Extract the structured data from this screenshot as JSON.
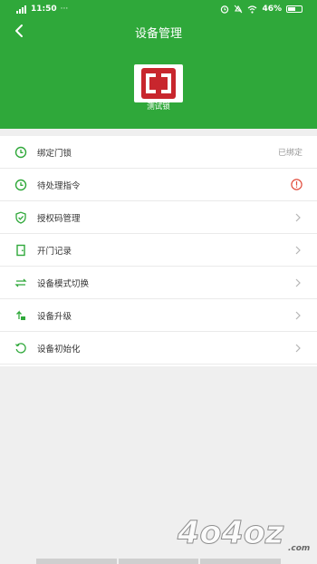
{
  "status_bar": {
    "time": "11:50",
    "battery": "46%"
  },
  "header": {
    "title": "设备管理"
  },
  "device": {
    "name": "测试锁"
  },
  "menu": [
    {
      "label": "绑定门锁",
      "status": "已绑定",
      "icon": "clock-icon"
    },
    {
      "label": "待处理指令",
      "icon": "clock-icon",
      "badge": "alert-icon"
    },
    {
      "label": "授权码管理",
      "icon": "shield-check-icon"
    },
    {
      "label": "开门记录",
      "icon": "door-icon"
    },
    {
      "label": "设备模式切换",
      "icon": "switch-icon"
    },
    {
      "label": "设备升级",
      "icon": "upgrade-icon"
    },
    {
      "label": "设备初始化",
      "icon": "reset-icon"
    }
  ],
  "watermark": {
    "text": "4o4oz",
    "suffix": ".com"
  },
  "colors": {
    "primary": "#2fa83a",
    "alert": "#e24b3b",
    "logo_red": "#c8262d"
  }
}
